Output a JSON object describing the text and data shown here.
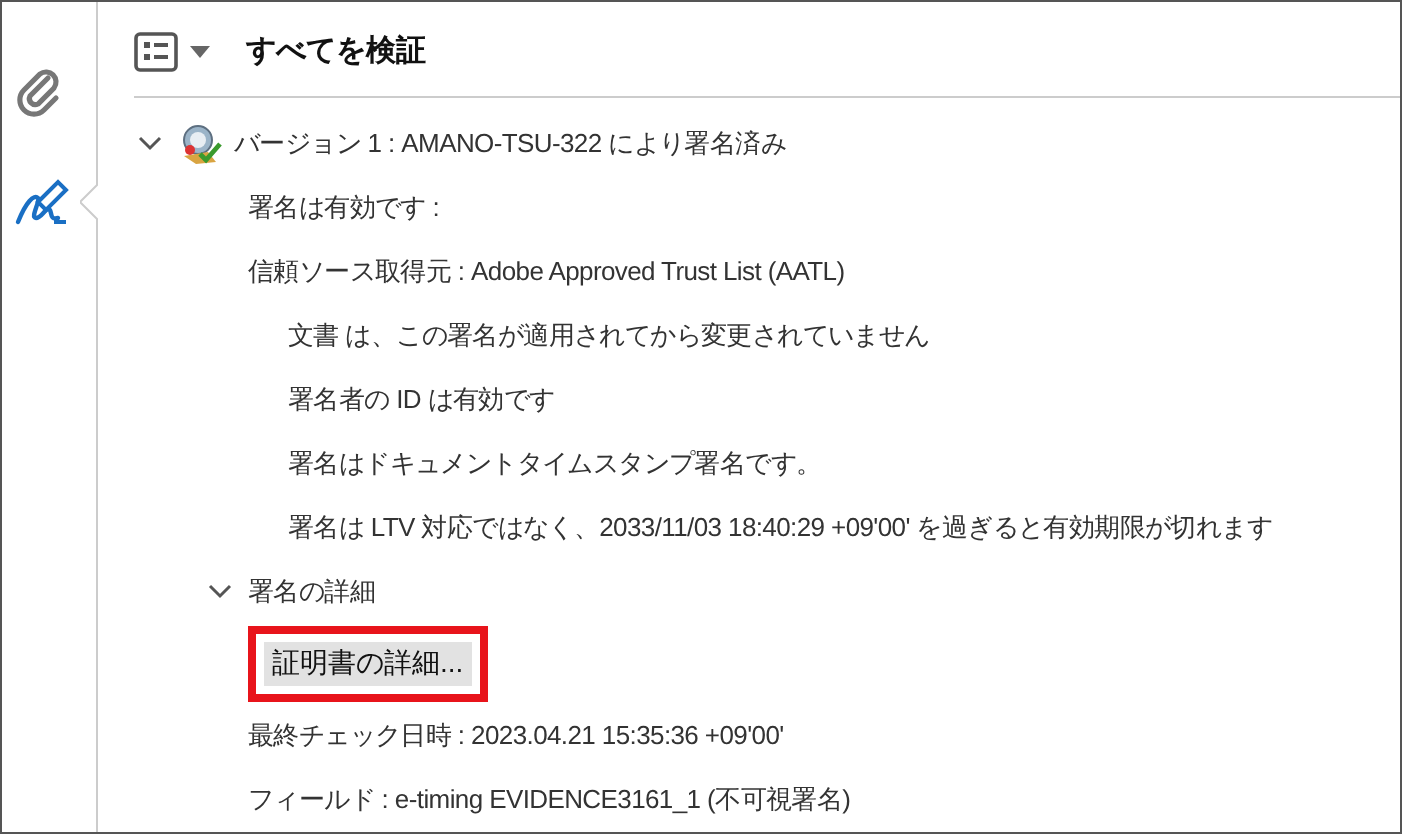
{
  "sidebar": {
    "items": [
      {
        "kind": "attachments",
        "selected": false
      },
      {
        "kind": "signatures",
        "selected": true
      }
    ]
  },
  "panel": {
    "title": "すべてを検証"
  },
  "tree": [
    {
      "text": "バージョン 1 : AMANO-TSU-322 により署名済み",
      "expanded": true,
      "children": [
        {
          "text": "署名は有効です :"
        },
        {
          "text": "信頼ソース取得元 : Adobe Approved Trust List (AATL)",
          "children": [
            {
              "text": "文書 は、この署名が適用されてから変更されていません"
            },
            {
              "text": "署名者の ID は有効です"
            },
            {
              "text": "署名はドキュメントタイムスタンプ署名です。"
            },
            {
              "text": "署名は LTV 対応ではなく、2033/11/03 18:40:29 +09'00' を過ぎると有効期限が切れます"
            }
          ]
        },
        {
          "text": "署名の詳細",
          "expanded": true,
          "children": [
            {
              "kind": "button",
              "text": "証明書の詳細...",
              "highlighted": true
            }
          ]
        },
        {
          "text": "最終チェック日時 : 2023.04.21 15:35:36 +09'00'"
        },
        {
          "text": "フィールド : e-timing EVIDENCE3161_1 (不可視署名)"
        }
      ]
    }
  ]
}
